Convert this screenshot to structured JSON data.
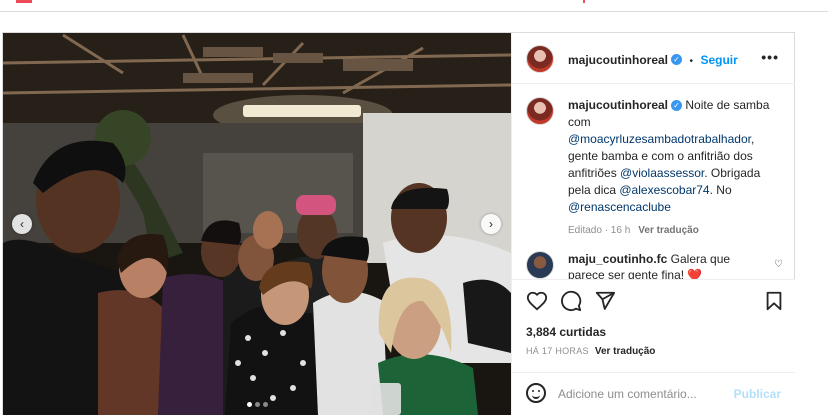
{
  "post": {
    "username": "majucoutinhoreal",
    "follow_label": "Seguir",
    "separator": "•",
    "more_label": "•••",
    "caption_parts": [
      {
        "text": " Noite de samba com ",
        "mention": false
      },
      {
        "text": "@moacyrluzesambadotrabalhador",
        "mention": true
      },
      {
        "text": ", gente bamba e com o anfitrião dos anfitriões ",
        "mention": false
      },
      {
        "text": "@violaassessor",
        "mention": true
      },
      {
        "text": ". Obrigada pela dica ",
        "mention": false
      },
      {
        "text": "@alexescobar74",
        "mention": true
      },
      {
        "text": ". No ",
        "mention": false
      },
      {
        "text": "@renascencaclube",
        "mention": true
      }
    ],
    "edited_time": "Editado · 16 h",
    "see_translation": "Ver tradução",
    "comment": {
      "username": "maju_coutinho.fc",
      "text": " Galera que parece ser gente fina! ❤️"
    },
    "likes": "3,884 curtidas",
    "posted_ago": "HÁ 17 HORAS",
    "post_translation": "Ver tradução",
    "add_comment_placeholder": "Adicione um comentário...",
    "publish_label": "Publicar"
  },
  "carousel": {
    "prev": "‹",
    "next": "›",
    "slide_count": 3,
    "active_slide": 1
  },
  "colors": {
    "accent": "#0095f6",
    "verified": "#3897f0",
    "mention": "#00376b",
    "muted": "#8e8e8e",
    "publish_disabled": "#b2dffc"
  }
}
